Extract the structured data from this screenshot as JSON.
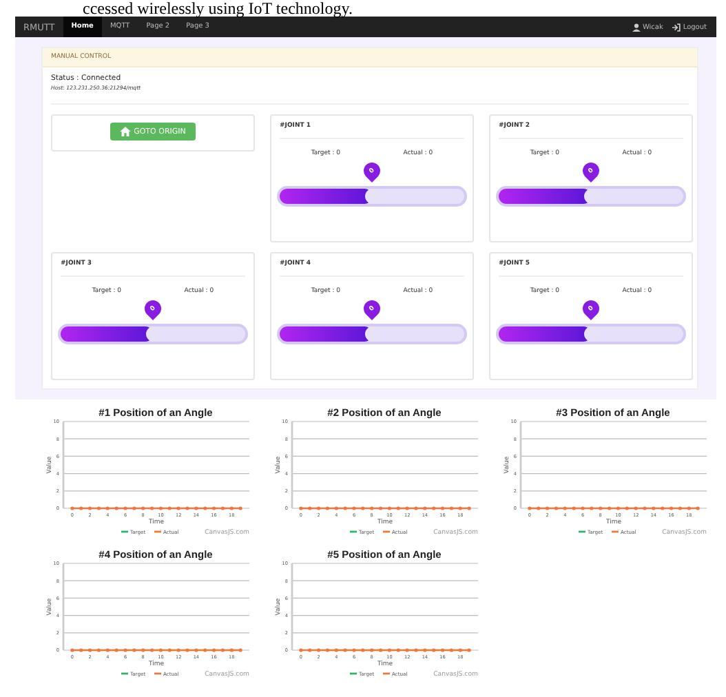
{
  "caption": "ccessed wirelessly using IoT technology.",
  "navbar": {
    "brand": "RMUTT",
    "tabs": [
      {
        "label": "Home",
        "selected": true
      },
      {
        "label": "MQTT",
        "selected": false
      },
      {
        "label": "Page 2",
        "selected": false
      },
      {
        "label": "Page 3",
        "selected": false
      }
    ],
    "user": "Wicak",
    "logout": "Logout"
  },
  "panel": {
    "title": "MANUAL CONTROL",
    "status": "Status : Connected",
    "host": "Host: 123.231.250.36:21294/mqtt",
    "goto_button": "GOTO ORIGIN",
    "joints": [
      {
        "title": "#JOINT 1",
        "target": "Target : 0",
        "actual": "Actual : 0",
        "value": "0",
        "level": 0.5
      },
      {
        "title": "#JOINT 2",
        "target": "Target : 0",
        "actual": "Actual : 0",
        "value": "0",
        "level": 0.5
      },
      {
        "title": "#JOINT 3",
        "target": "Target : 0",
        "actual": "Actual : 0",
        "value": "0",
        "level": 0.5
      },
      {
        "title": "#JOINT 4",
        "target": "Target : 0",
        "actual": "Actual : 0",
        "value": "0",
        "level": 0.5
      },
      {
        "title": "#JOINT 5",
        "target": "Target : 0",
        "actual": "Actual : 0",
        "value": "0",
        "level": 0.5
      }
    ]
  },
  "charts": [
    {
      "credit": "CanvasJS.com",
      "chart_data": {
        "type": "line",
        "title": "#1  Position of an Angle",
        "xlabel": "Time",
        "ylabel": "Value",
        "grid": true,
        "legend": "bottom",
        "x": [
          0,
          1,
          2,
          3,
          4,
          5,
          6,
          7,
          8,
          9,
          10,
          11,
          12,
          13,
          14,
          15,
          16,
          17,
          18,
          19
        ],
        "xlim": [
          -1,
          20
        ],
        "ylim": [
          0,
          10
        ],
        "yticks": [
          0,
          2,
          4,
          6,
          8,
          10
        ],
        "xticks": [
          0,
          2,
          4,
          6,
          8,
          10,
          12,
          14,
          16,
          18
        ],
        "series": [
          {
            "name": "Target",
            "color": "#2fb56a",
            "values": [
              null,
              null,
              null,
              null,
              null,
              null,
              null,
              null,
              null,
              null,
              null,
              null,
              null,
              null,
              null,
              null,
              null,
              null,
              null,
              null
            ]
          },
          {
            "name": "Actual",
            "color": "#f0763c",
            "values": [
              0,
              0,
              0,
              0,
              0,
              0,
              0,
              0,
              0,
              0,
              0,
              0,
              0,
              0,
              0,
              0,
              0,
              0,
              0,
              0
            ]
          }
        ]
      }
    },
    {
      "credit": "CanvasJS.com",
      "chart_data": {
        "type": "line",
        "title": "#2  Position of an Angle",
        "xlabel": "Time",
        "ylabel": "Value",
        "grid": true,
        "legend": "bottom",
        "x": [
          0,
          1,
          2,
          3,
          4,
          5,
          6,
          7,
          8,
          9,
          10,
          11,
          12,
          13,
          14,
          15,
          16,
          17,
          18,
          19
        ],
        "xlim": [
          -1,
          20
        ],
        "ylim": [
          0,
          10
        ],
        "yticks": [
          0,
          2,
          4,
          6,
          8,
          10
        ],
        "xticks": [
          0,
          2,
          4,
          6,
          8,
          10,
          12,
          14,
          16,
          18
        ],
        "series": [
          {
            "name": "Target",
            "color": "#2fb56a",
            "values": [
              null,
              null,
              null,
              null,
              null,
              null,
              null,
              null,
              null,
              null,
              null,
              null,
              null,
              null,
              null,
              null,
              null,
              null,
              null,
              null
            ]
          },
          {
            "name": "Actual",
            "color": "#f0763c",
            "values": [
              0,
              0,
              0,
              0,
              0,
              0,
              0,
              0,
              0,
              0,
              0,
              0,
              0,
              0,
              0,
              0,
              0,
              0,
              0,
              0
            ]
          }
        ]
      }
    },
    {
      "credit": "CanvasJS.com",
      "chart_data": {
        "type": "line",
        "title": "#3  Position of an Angle",
        "xlabel": "Time",
        "ylabel": "Value",
        "grid": true,
        "legend": "bottom",
        "x": [
          0,
          1,
          2,
          3,
          4,
          5,
          6,
          7,
          8,
          9,
          10,
          11,
          12,
          13,
          14,
          15,
          16,
          17,
          18,
          19
        ],
        "xlim": [
          -1,
          20
        ],
        "ylim": [
          0,
          10
        ],
        "yticks": [
          0,
          2,
          4,
          6,
          8,
          10
        ],
        "xticks": [
          0,
          2,
          4,
          6,
          8,
          10,
          12,
          14,
          16,
          18
        ],
        "series": [
          {
            "name": "Target",
            "color": "#2fb56a",
            "values": [
              null,
              null,
              null,
              null,
              null,
              null,
              null,
              null,
              null,
              null,
              null,
              null,
              null,
              null,
              null,
              null,
              null,
              null,
              null,
              null
            ]
          },
          {
            "name": "Actual",
            "color": "#f0763c",
            "values": [
              0,
              0,
              0,
              0,
              0,
              0,
              0,
              0,
              0,
              0,
              0,
              0,
              0,
              0,
              0,
              0,
              0,
              0,
              0,
              0
            ]
          }
        ]
      }
    },
    {
      "credit": "CanvasJS.com",
      "chart_data": {
        "type": "line",
        "title": "#4  Position of an Angle",
        "xlabel": "Time",
        "ylabel": "Value",
        "grid": true,
        "legend": "bottom",
        "x": [
          0,
          1,
          2,
          3,
          4,
          5,
          6,
          7,
          8,
          9,
          10,
          11,
          12,
          13,
          14,
          15,
          16,
          17,
          18,
          19
        ],
        "xlim": [
          -1,
          20
        ],
        "ylim": [
          0,
          10
        ],
        "yticks": [
          0,
          2,
          4,
          6,
          8,
          10
        ],
        "xticks": [
          0,
          2,
          4,
          6,
          8,
          10,
          12,
          14,
          16,
          18
        ],
        "series": [
          {
            "name": "Target",
            "color": "#2fb56a",
            "values": [
              null,
              null,
              null,
              null,
              null,
              null,
              null,
              null,
              null,
              null,
              null,
              null,
              null,
              null,
              null,
              null,
              null,
              null,
              null,
              null
            ]
          },
          {
            "name": "Actual",
            "color": "#f0763c",
            "values": [
              0,
              0,
              0,
              0,
              0,
              0,
              0,
              0,
              0,
              0,
              0,
              0,
              0,
              0,
              0,
              0,
              0,
              0,
              0,
              0
            ]
          }
        ]
      }
    },
    {
      "credit": "CanvasJS.com",
      "chart_data": {
        "type": "line",
        "title": "#5  Position of an Angle",
        "xlabel": "Time",
        "ylabel": "Value",
        "grid": true,
        "legend": "bottom",
        "x": [
          0,
          1,
          2,
          3,
          4,
          5,
          6,
          7,
          8,
          9,
          10,
          11,
          12,
          13,
          14,
          15,
          16,
          17,
          18,
          19
        ],
        "xlim": [
          -1,
          20
        ],
        "ylim": [
          0,
          10
        ],
        "yticks": [
          0,
          2,
          4,
          6,
          8,
          10
        ],
        "xticks": [
          0,
          2,
          4,
          6,
          8,
          10,
          12,
          14,
          16,
          18
        ],
        "series": [
          {
            "name": "Target",
            "color": "#2fb56a",
            "values": [
              null,
              null,
              null,
              null,
              null,
              null,
              null,
              null,
              null,
              null,
              null,
              null,
              null,
              null,
              null,
              null,
              null,
              null,
              null,
              null
            ]
          },
          {
            "name": "Actual",
            "color": "#f0763c",
            "values": [
              0,
              0,
              0,
              0,
              0,
              0,
              0,
              0,
              0,
              0,
              0,
              0,
              0,
              0,
              0,
              0,
              0,
              0,
              0,
              0
            ]
          }
        ]
      }
    }
  ]
}
